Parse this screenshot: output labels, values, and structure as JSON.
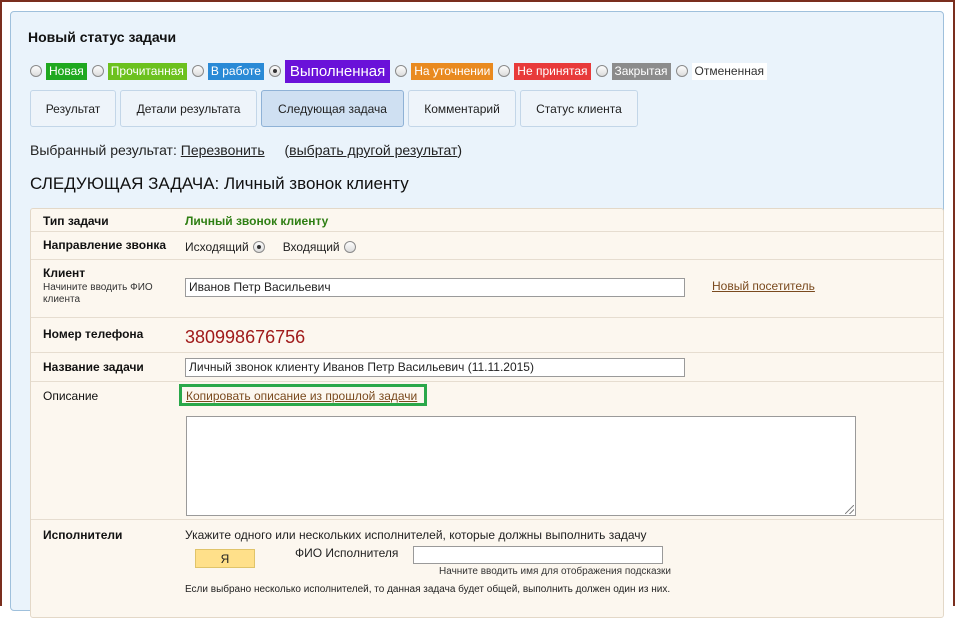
{
  "panel": {
    "title": "Новый статус задачи"
  },
  "statuses": [
    {
      "label": "Новая",
      "color": "#1fa81f",
      "checked": false
    },
    {
      "label": "Прочитанная",
      "color": "#6cc11e",
      "checked": false
    },
    {
      "label": "В работе",
      "color": "#2a8ad6",
      "checked": false
    },
    {
      "label": "Выполненная",
      "color": "#6a11d9",
      "checked": true
    },
    {
      "label": "На уточнении",
      "color": "#e98a20",
      "checked": false
    },
    {
      "label": "Не принятая",
      "color": "#e83a3a",
      "checked": false
    },
    {
      "label": "Закрытая",
      "color": "#8c8c8c",
      "checked": false
    },
    {
      "label": "Отмененная",
      "color": "#ffffff",
      "checked": false
    }
  ],
  "tabs": [
    {
      "label": "Результат",
      "active": false
    },
    {
      "label": "Детали результата",
      "active": false
    },
    {
      "label": "Следующая задача",
      "active": true
    },
    {
      "label": "Комментарий",
      "active": false
    },
    {
      "label": "Статус клиента",
      "active": false
    }
  ],
  "selected_result": {
    "prefix": "Выбранный результат:",
    "value": "Перезвонить",
    "change_open": "(",
    "change_link": "выбрать другой результат",
    "change_close": ")"
  },
  "section_title": "СЛЕДУЮЩАЯ ЗАДАЧА: Личный звонок клиенту",
  "form": {
    "task_type_label": "Тип задачи",
    "task_type_value": "Личный звонок клиенту",
    "direction_label": "Направление звонка",
    "direction_outgoing": "Исходящий",
    "direction_incoming": "Входящий",
    "client_label": "Клиент",
    "client_hint": "Начините вводить ФИО клиента",
    "client_value": "Иванов Петр Васильевич",
    "new_visitor_link": "Новый посетитель",
    "phone_label": "Номер телефона",
    "phone_value": "380998676756",
    "task_name_label": "Название задачи",
    "task_name_value": "Личный звонок клиенту Иванов Петр Васильевич (11.11.2015)",
    "description_label": "Описание",
    "copy_description_link": "Копировать описание из прошлой задачи",
    "description_value": "",
    "executors_label": "Исполнители",
    "executors_hint": "Укажите одного или нескольких исполнителей, которые должны выполнить задачу",
    "me_button": "Я",
    "executor_name_label": "ФИО Исполнителя",
    "executor_name_value": "",
    "executor_name_hint": "Начните вводить имя для отображения подсказки",
    "executors_note": "Если выбрано несколько исполнителей, то данная задача будет общей, выполнить должен один из них."
  }
}
